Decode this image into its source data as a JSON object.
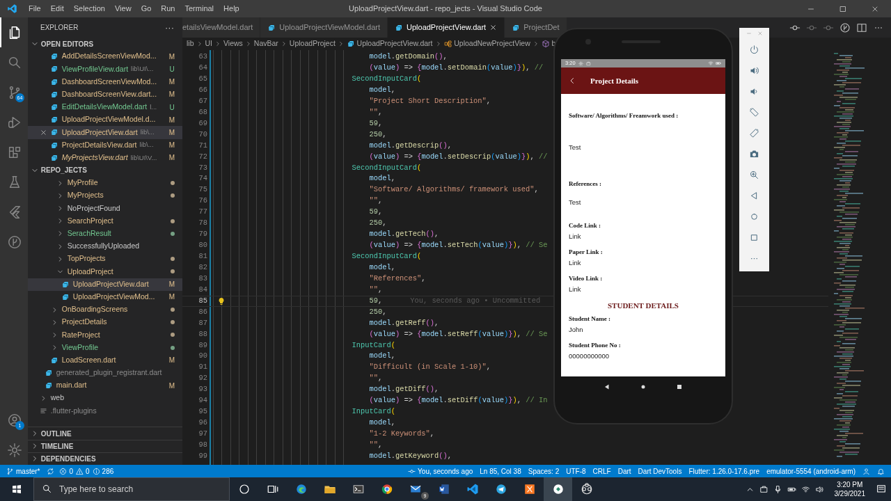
{
  "window": {
    "title": "UploadProjectView.dart - repo_jects - Visual Studio Code",
    "menu": [
      "File",
      "Edit",
      "Selection",
      "View",
      "Go",
      "Run",
      "Terminal",
      "Help"
    ]
  },
  "activity_bar": {
    "items": [
      {
        "kind": "explorer",
        "selected": true
      },
      {
        "kind": "search",
        "selected": false
      },
      {
        "kind": "source_control",
        "selected": false,
        "badge": "64"
      },
      {
        "kind": "run",
        "selected": false
      },
      {
        "kind": "extensions",
        "selected": false
      },
      {
        "kind": "testing",
        "selected": false
      },
      {
        "kind": "flutter",
        "selected": false
      },
      {
        "kind": "git_graph",
        "selected": false
      }
    ],
    "bottom": [
      {
        "kind": "account",
        "badge": "1"
      },
      {
        "kind": "settings"
      }
    ]
  },
  "sidebar": {
    "title": "EXPLORER",
    "more": "···",
    "open_editors": {
      "title": "OPEN EDITORS",
      "expanded": true,
      "items": [
        {
          "label": "AddDetailsScreenViewMod...",
          "badge": "M",
          "color": "#e2c08d",
          "selected": false,
          "preview": false
        },
        {
          "label": "ViewProfileView.dart",
          "description": "lib\\UI\\...",
          "badge": "U",
          "color": "#73c991",
          "selected": false,
          "preview": false
        },
        {
          "label": "DashboardScreenViewMod...",
          "badge": "M",
          "color": "#e2c08d",
          "selected": false,
          "preview": false
        },
        {
          "label": "DashboardScreenView.dart...",
          "badge": "M",
          "color": "#e2c08d",
          "selected": false,
          "preview": false
        },
        {
          "label": "EditDetailsViewModel.dart",
          "description": "l...",
          "badge": "U",
          "color": "#73c991",
          "selected": false,
          "preview": false
        },
        {
          "label": "UploadProjectViewModel.d...",
          "badge": "M",
          "color": "#e2c08d",
          "selected": false,
          "preview": false
        },
        {
          "label": "UploadProjectView.dart",
          "description": "lib\\...",
          "badge": "M",
          "color": "#e2c08d",
          "selected": true,
          "preview": false
        },
        {
          "label": "ProjectDetailsView.dart",
          "description": "lib\\...",
          "badge": "M",
          "color": "#e2c08d",
          "selected": false,
          "preview": false
        },
        {
          "label": "MyProjectsView.dart",
          "description": "lib\\UI\\V...",
          "badge": "M",
          "color": "#e2c08d",
          "selected": false,
          "preview": true
        }
      ]
    },
    "project": {
      "title": "REPO_JECTS",
      "expanded": true
    },
    "tree": [
      {
        "children": [
          {
            "children": [
              {
                "children": [
                  {
                    "label": "MyProfile",
                    "kind": "folder",
                    "expanded": false,
                    "selected": false,
                    "color": "#e2c08d",
                    "dot": true
                  },
                  {
                    "label": "MyProjects",
                    "kind": "folder",
                    "expanded": false,
                    "selected": false,
                    "color": "#e2c08d",
                    "dot": true
                  },
                  {
                    "label": "NoProjectFound",
                    "kind": "folder",
                    "expanded": false,
                    "selected": false,
                    "color": "#cccccc",
                    "dot": false
                  },
                  {
                    "label": "SearchProject",
                    "kind": "folder",
                    "expanded": false,
                    "selected": false,
                    "color": "#e2c08d",
                    "dot": true
                  },
                  {
                    "label": "SerachResult",
                    "kind": "folder",
                    "expanded": false,
                    "selected": false,
                    "color": "#73c991",
                    "dot": true
                  },
                  {
                    "label": "SuccessfullyUploaded",
                    "kind": "folder",
                    "expanded": false,
                    "selected": false,
                    "color": "#cccccc",
                    "dot": false
                  },
                  {
                    "label": "TopProjects",
                    "kind": "folder",
                    "expanded": false,
                    "selected": false,
                    "color": "#e2c08d",
                    "dot": true
                  },
                  {
                    "label": "UploadProject",
                    "kind": "folder",
                    "expanded": true,
                    "selected": false,
                    "color": "#e2c08d",
                    "dot": true,
                    "children": [
                      {
                        "label": "UploadProjectView.dart",
                        "kind": "file",
                        "selected": true,
                        "color": "#e2c08d",
                        "badge": "M"
                      },
                      {
                        "label": "UploadProjectViewMod...",
                        "kind": "file",
                        "selected": false,
                        "color": "#e2c08d",
                        "badge": "M"
                      }
                    ]
                  }
                ]
              },
              {
                "label": "OnBoardingScreens",
                "kind": "folder",
                "expanded": false,
                "selected": false,
                "color": "#e2c08d",
                "dot": true
              },
              {
                "label": "ProjectDetails",
                "kind": "folder",
                "expanded": false,
                "selected": false,
                "color": "#e2c08d",
                "dot": true
              },
              {
                "label": "RateProject",
                "kind": "folder",
                "expanded": false,
                "selected": false,
                "color": "#e2c08d",
                "dot": true
              },
              {
                "label": "ViewProfile",
                "kind": "folder",
                "expanded": false,
                "selected": false,
                "color": "#73c991",
                "dot": true
              },
              {
                "label": "LoadScreen.dart",
                "kind": "file",
                "selected": false,
                "color": "#e2c08d",
                "badge": "M"
              }
            ]
          },
          {
            "label": "generated_plugin_registrant.dart",
            "kind": "file",
            "selected": false,
            "color": "#8c8c8c"
          },
          {
            "label": "main.dart",
            "kind": "file",
            "selected": false,
            "color": "#e2c08d",
            "badge": "M"
          }
        ]
      },
      {
        "label": "web",
        "kind": "folder",
        "expanded": false,
        "selected": false,
        "color": "#cccccc",
        "dot": false
      },
      {
        "label": ".flutter-plugins",
        "kind": "config",
        "selected": false,
        "color": "#8c8c8c"
      }
    ],
    "sections": [
      {
        "title": "OUTLINE",
        "expanded": false
      },
      {
        "title": "TIMELINE",
        "expanded": false
      },
      {
        "title": "DEPENDENCIES",
        "expanded": false
      }
    ]
  },
  "editor": {
    "tabs": [
      {
        "label": "etailsViewModel.dart",
        "selected": false,
        "clipped": true
      },
      {
        "label": "UploadProjectViewModel.dart",
        "selected": false,
        "clipped": false
      },
      {
        "label": "UploadProjectView.dart",
        "selected": true,
        "clipped": false
      },
      {
        "label": "ProjectDet",
        "selected": false,
        "clipped": false
      }
    ],
    "actions": [
      {
        "kind": "commit",
        "disabled": false
      },
      {
        "kind": "commit",
        "disabled": true
      },
      {
        "kind": "commit",
        "disabled": true
      },
      {
        "kind": "branch_circle",
        "disabled": false
      },
      {
        "kind": "split",
        "disabled": false
      },
      {
        "kind": "more",
        "disabled": false
      }
    ],
    "breadcrumb": [
      {
        "label": "lib",
        "kind": "folder"
      },
      {
        "label": "UI",
        "kind": "folder"
      },
      {
        "label": "Views",
        "kind": "folder"
      },
      {
        "label": "NavBar",
        "kind": "folder"
      },
      {
        "label": "UploadProject",
        "kind": "folder"
      },
      {
        "label": "UploadProjectView.dart",
        "kind": "file"
      },
      {
        "label": "UploadNewProjectView",
        "kind": "class"
      },
      {
        "label": "b",
        "kind": "member"
      }
    ],
    "lines": [
      {
        "number": "63",
        "text": "                                    model.getDomain(),",
        "current": false
      },
      {
        "number": "64",
        "text": "                                    (value) => {model.setDomain(value)}), //",
        "current": false
      },
      {
        "number": "65",
        "text": "                                SecondInputCard(",
        "current": false
      },
      {
        "number": "66",
        "text": "                                    model,",
        "current": false
      },
      {
        "number": "67",
        "text": "                                    \"Project Short Description\",",
        "current": false
      },
      {
        "number": "68",
        "text": "                                    \"\",",
        "current": false
      },
      {
        "number": "69",
        "text": "                                    59,",
        "current": false
      },
      {
        "number": "70",
        "text": "                                    250,",
        "current": false
      },
      {
        "number": "71",
        "text": "                                    model.getDescrip(),",
        "current": false
      },
      {
        "number": "72",
        "text": "                                    (value) => {model.setDescrip(value)}), //",
        "current": false
      },
      {
        "number": "73",
        "text": "                                SecondInputCard(",
        "current": false
      },
      {
        "number": "74",
        "text": "                                    model,",
        "current": false
      },
      {
        "number": "75",
        "text": "                                    \"Software/ Algorithms/ framework used\",",
        "current": false
      },
      {
        "number": "76",
        "text": "                                    \"\",",
        "current": false
      },
      {
        "number": "77",
        "text": "                                    59,",
        "current": false
      },
      {
        "number": "78",
        "text": "                                    250,",
        "current": false
      },
      {
        "number": "79",
        "text": "                                    model.getTech(),",
        "current": false
      },
      {
        "number": "80",
        "text": "                                    (value) => {model.setTech(value)}), // Se",
        "current": false
      },
      {
        "number": "81",
        "text": "                                SecondInputCard(",
        "current": false
      },
      {
        "number": "82",
        "text": "                                    model,",
        "current": false
      },
      {
        "number": "83",
        "text": "                                    \"References\",",
        "current": false
      },
      {
        "number": "84",
        "text": "                                    \"\",",
        "current": false
      },
      {
        "number": "85",
        "text": "                                    59,",
        "current": true,
        "annotation": "You, seconds ago • Uncommitted"
      },
      {
        "number": "86",
        "text": "                                    250,",
        "current": false
      },
      {
        "number": "87",
        "text": "                                    model.getReff(),",
        "current": false
      },
      {
        "number": "88",
        "text": "                                    (value) => {model.setReff(value)}), // Se",
        "current": false
      },
      {
        "number": "89",
        "text": "                                InputCard(",
        "current": false
      },
      {
        "number": "90",
        "text": "                                    model,",
        "current": false
      },
      {
        "number": "91",
        "text": "                                    \"Difficult (in Scale 1-10)\",",
        "current": false
      },
      {
        "number": "92",
        "text": "                                    \"\",",
        "current": false
      },
      {
        "number": "93",
        "text": "                                    model.getDiff(),",
        "current": false
      },
      {
        "number": "94",
        "text": "                                    (value) => {model.setDiff(value)}), // In",
        "current": false
      },
      {
        "number": "95",
        "text": "                                InputCard(",
        "current": false
      },
      {
        "number": "96",
        "text": "                                    model,",
        "current": false
      },
      {
        "number": "97",
        "text": "                                    \"1-2 Keywords\",",
        "current": false
      },
      {
        "number": "98",
        "text": "                                    \"\",",
        "current": false
      },
      {
        "number": "99",
        "text": "                                    model.getKeyword(),",
        "current": false
      }
    ]
  },
  "status_bar": {
    "left": [
      {
        "kind": "branch",
        "label": "master*"
      },
      {
        "kind": "sync"
      },
      {
        "kind": "error",
        "label": "0"
      },
      {
        "kind": "warning",
        "label": "0"
      },
      {
        "kind": "info",
        "label": "286"
      }
    ],
    "right": [
      {
        "kind": "blame",
        "label": "You, seconds ago"
      },
      {
        "kind": "text",
        "label": "Ln 85, Col 38"
      },
      {
        "kind": "text",
        "label": "Spaces: 2"
      },
      {
        "kind": "text",
        "label": "UTF-8"
      },
      {
        "kind": "text",
        "label": "CRLF"
      },
      {
        "kind": "text",
        "label": "Dart"
      },
      {
        "kind": "text",
        "label": "Dart DevTools"
      },
      {
        "kind": "text",
        "label": "Flutter: 1.26.0-17.6.pre"
      },
      {
        "kind": "text",
        "label": "emulator-5554 (android-arm)"
      },
      {
        "kind": "feedback"
      },
      {
        "kind": "bell"
      }
    ]
  },
  "phone": {
    "status_time": "3:20",
    "title": "Project Details",
    "fields": [
      {
        "kind": "long",
        "label": "Software/ Algorithms/ Freamwork used :",
        "value": "Test"
      },
      {
        "kind": "medium",
        "label": "References :",
        "value": "Test"
      },
      {
        "kind": "short",
        "label": "Code Link :",
        "value": "Link"
      },
      {
        "kind": "short",
        "label": "Paper Link :",
        "value": "Link"
      },
      {
        "kind": "short",
        "label": "Video Link :",
        "value": "Link"
      },
      {
        "kind": "heading",
        "label": "STUDENT DETAILS"
      },
      {
        "kind": "short",
        "label": "Student Name :",
        "value": "John"
      },
      {
        "kind": "short",
        "label": "Student Phone No :",
        "value": "00000000000"
      }
    ]
  },
  "emulator_toolbar": [
    {
      "kind": "power"
    },
    {
      "kind": "volume_up"
    },
    {
      "kind": "volume_down"
    },
    {
      "kind": "rotate_left"
    },
    {
      "kind": "rotate_right"
    },
    {
      "kind": "camera"
    },
    {
      "kind": "zoom"
    },
    {
      "kind": "back"
    },
    {
      "kind": "home"
    },
    {
      "kind": "overview"
    },
    {
      "kind": "more"
    }
  ],
  "taskbar": {
    "search_placeholder": "Type here to search",
    "apps": [
      {
        "kind": "cortana",
        "active": false
      },
      {
        "kind": "task_view",
        "active": false
      },
      {
        "kind": "edge",
        "active": false
      },
      {
        "kind": "files",
        "active": false
      },
      {
        "kind": "terminal",
        "active": false
      },
      {
        "kind": "chrome",
        "active": false
      },
      {
        "kind": "mail",
        "active": false,
        "badge": "9"
      },
      {
        "kind": "word",
        "active": false
      },
      {
        "kind": "vscode",
        "active": false
      },
      {
        "kind": "telegram",
        "active": false
      },
      {
        "kind": "xampp",
        "active": false
      },
      {
        "kind": "app",
        "active": true
      },
      {
        "kind": "obs",
        "active": false
      }
    ],
    "tray": [
      {
        "kind": "chevron_up"
      },
      {
        "kind": "tray_box"
      },
      {
        "kind": "mic"
      },
      {
        "kind": "battery"
      },
      {
        "kind": "wifi"
      },
      {
        "kind": "volume"
      }
    ],
    "time": "3:20 PM",
    "date": "3/29/2021"
  }
}
